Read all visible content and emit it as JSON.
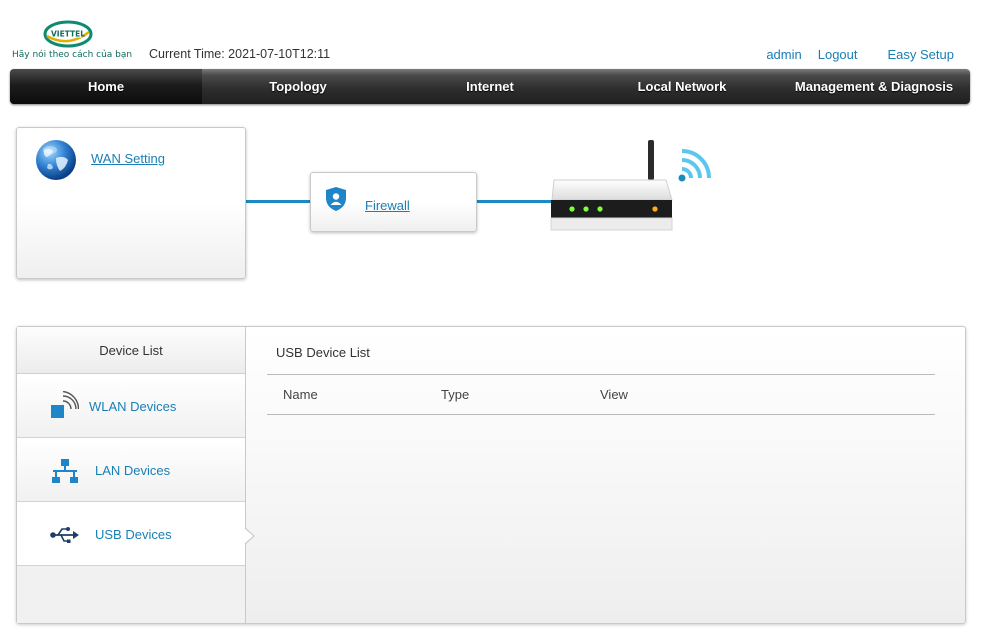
{
  "brand": {
    "logo_text": "VIETTEL",
    "slogan": "Hãy nói theo cách của bạn",
    "color": "#0f6b5e"
  },
  "header": {
    "current_time": "Current Time: 2021-07-10T12:11",
    "links": {
      "admin": "admin",
      "logout": "Logout",
      "easy_setup": "Easy Setup"
    }
  },
  "nav": {
    "tabs": [
      {
        "label": "Home",
        "active": true
      },
      {
        "label": "Topology",
        "active": false
      },
      {
        "label": "Internet",
        "active": false
      },
      {
        "label": "Local Network",
        "active": false
      },
      {
        "label": "Management & Diagnosis",
        "active": false
      }
    ]
  },
  "topology": {
    "wan": {
      "label": "WAN Setting",
      "icon": "globe-icon"
    },
    "firewall": {
      "label": "Firewall",
      "icon": "shield-icon"
    },
    "router": {
      "icon": "router-icon",
      "wifi_icon": "wifi-icon"
    },
    "accent_color": "#1a8ac0"
  },
  "device_panel": {
    "sidebar": {
      "title": "Device List",
      "items": [
        {
          "label": "WLAN Devices",
          "icon": "wlan-icon",
          "active": false
        },
        {
          "label": "LAN Devices",
          "icon": "lan-icon",
          "active": false
        },
        {
          "label": "USB Devices",
          "icon": "usb-icon",
          "active": true
        }
      ]
    },
    "content": {
      "title": "USB Device List",
      "columns": [
        "Name",
        "Type",
        "View"
      ],
      "rows": []
    }
  },
  "colors": {
    "link": "#1a7fb5",
    "nav_bg": "#2e2e2e"
  }
}
